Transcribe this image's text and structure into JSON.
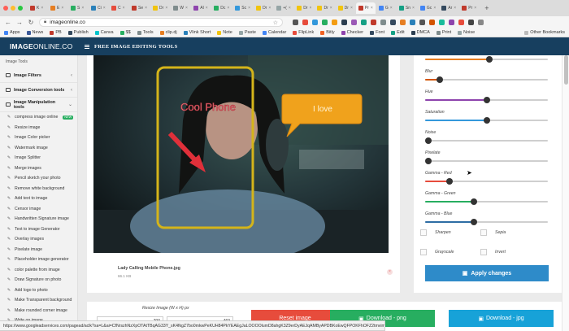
{
  "browser": {
    "tabs": [
      {
        "label": "K",
        "color": "#c0392b"
      },
      {
        "label": "E",
        "color": "#e67e22"
      },
      {
        "label": "S",
        "color": "#27ae60"
      },
      {
        "label": "Ci",
        "color": "#2980b9"
      },
      {
        "label": "C",
        "color": "#e74c3c"
      },
      {
        "label": "Se",
        "color": "#c0392b"
      },
      {
        "label": "Dr",
        "color": "#f1c40f"
      },
      {
        "label": "W",
        "color": "#7f8c8d"
      },
      {
        "label": "Al",
        "color": "#8e44ad"
      },
      {
        "label": "Dc",
        "color": "#27ae60"
      },
      {
        "label": "Sc",
        "color": "#3498db"
      },
      {
        "label": "Dr",
        "color": "#f1c40f"
      },
      {
        "label": "+(",
        "color": "#95a5a6"
      },
      {
        "label": "Dr",
        "color": "#f1c40f"
      },
      {
        "label": "Dr",
        "color": "#f1c40f"
      },
      {
        "label": "Dr",
        "color": "#f1c40f"
      },
      {
        "label": "Pr",
        "color": "#c0392b",
        "active": true
      },
      {
        "label": "G",
        "color": "#4285f4"
      },
      {
        "label": "Sn",
        "color": "#16a085"
      },
      {
        "label": "Gc",
        "color": "#4285f4"
      },
      {
        "label": "Ar",
        "color": "#34495e"
      },
      {
        "label": "Pr",
        "color": "#c0392b"
      }
    ],
    "new_tab": "+",
    "url": "imageonline.co",
    "bookmarks": [
      {
        "label": "Apps",
        "color": "#4285f4"
      },
      {
        "label": "News",
        "color": "#3b5998"
      },
      {
        "label": "PB",
        "color": "#c0392b"
      },
      {
        "label": "Publish",
        "color": "#34495e"
      },
      {
        "label": "Canva",
        "color": "#00c4cc"
      },
      {
        "label": "$$",
        "color": "#27ae60"
      },
      {
        "label": "Tools",
        "color": "#7f8c8d"
      },
      {
        "label": "clip.dj",
        "color": "#e67e22"
      },
      {
        "label": "Vlink Short",
        "color": "#2980b9"
      },
      {
        "label": "Note",
        "color": "#f1c40f"
      },
      {
        "label": "Paste",
        "color": "#95a5a6"
      },
      {
        "label": "Calendar",
        "color": "#4285f4"
      },
      {
        "label": "FlipLink",
        "color": "#e74c3c"
      },
      {
        "label": "Bitly",
        "color": "#ee6123"
      },
      {
        "label": "Checker",
        "color": "#8e44ad"
      },
      {
        "label": "Font",
        "color": "#34495e"
      },
      {
        "label": "Edit",
        "color": "#16a085"
      },
      {
        "label": "DMCA",
        "color": "#2c3e50"
      },
      {
        "label": "Print",
        "color": "#7f8c8d"
      },
      {
        "label": "Noise",
        "color": "#95a5a6"
      }
    ],
    "other_bookmarks": "Other Bookmarks"
  },
  "site": {
    "logo_bold": "IMAGE",
    "logo_thin": "ONLINE.CO",
    "menu_label": "FREE IMAGE EDITING TOOLS"
  },
  "sidebar": {
    "title": "Image Tools",
    "sections": [
      {
        "label": "Image Filters",
        "chevron": "‹"
      },
      {
        "label": "Image Conversion tools",
        "chevron": "‹"
      },
      {
        "label": "Image Manipulation tools",
        "chevron": "⌄"
      }
    ],
    "items": [
      {
        "label": "compress image online",
        "icon": "✎",
        "badge": "NEW"
      },
      {
        "label": "Resize image",
        "icon": "✎"
      },
      {
        "label": "Image Color picker",
        "icon": "✎"
      },
      {
        "label": "Watermark image",
        "icon": "✎"
      },
      {
        "label": "Image Splitter",
        "icon": "✎"
      },
      {
        "label": "Merge images",
        "icon": "✎"
      },
      {
        "label": "Pencil sketch your photo",
        "icon": "✎"
      },
      {
        "label": "Remove white background",
        "icon": "✎"
      },
      {
        "label": "Add text to image",
        "icon": "✎"
      },
      {
        "label": "Censor image",
        "icon": "✎"
      },
      {
        "label": "Handwritten Signature image",
        "icon": "✎"
      },
      {
        "label": "Text to image Generator",
        "icon": "✎"
      },
      {
        "label": "Overlay images",
        "icon": "✎"
      },
      {
        "label": "Pixelate image",
        "icon": "✎"
      },
      {
        "label": "Placeholder image generator",
        "icon": "✎"
      },
      {
        "label": "color palette from image",
        "icon": "✎"
      },
      {
        "label": "Draw Signature on photo",
        "icon": "✎"
      },
      {
        "label": "Add logo to photo",
        "icon": "✎"
      },
      {
        "label": "Make Transparent background",
        "icon": "✎"
      },
      {
        "label": "Make rounded corner image",
        "icon": "✎"
      },
      {
        "label": "Write on image",
        "icon": "✎"
      }
    ]
  },
  "editor": {
    "photo_text_left": "Cool Phone",
    "photo_text_right": "I love",
    "file_name": "Lady Calling Mobile Phone.jpg",
    "file_size": "66.1 KB",
    "remove_icon": "×"
  },
  "adjustments": {
    "sliders": [
      {
        "label": "",
        "value": 0.52,
        "color": "#e67e22"
      },
      {
        "label": "Blur",
        "value": 0.12,
        "color": "#d35400"
      },
      {
        "label": "Hue",
        "value": 0.5,
        "color": "#8e44ad"
      },
      {
        "label": "Saturation",
        "value": 0.5,
        "color": "#3498db"
      },
      {
        "label": "Noise",
        "value": 0.0,
        "color": "#2c3e50"
      },
      {
        "label": "Pixelate",
        "value": 0.0,
        "color": "#2c3e50"
      },
      {
        "label": "Gamma - Red",
        "value": 0.2,
        "color": "#e74c3c"
      },
      {
        "label": "Gamma - Green",
        "value": 0.4,
        "color": "#27ae60"
      },
      {
        "label": "Gamma - Blue",
        "value": 0.4,
        "color": "#2e6da4"
      }
    ],
    "checkboxes": [
      {
        "label": "Sharpen"
      },
      {
        "label": "Sepia"
      },
      {
        "label": "Grayscale"
      },
      {
        "label": "Invert"
      }
    ],
    "apply_label": "Apply changes",
    "apply_icon": "▣"
  },
  "bottom": {
    "resize_label": "Resize Image (W x H) px",
    "width_value": "700",
    "height_value": "469",
    "reset_label": "Reset image",
    "png_label": "Download - png",
    "jpg_label": "Download - jpg",
    "download_icon": "▣",
    "colors": {
      "reset": "#e74c3c",
      "png": "#27ae60",
      "jpg": "#17a2d8"
    }
  },
  "status_url": "https://www.googleadservices.com/pagead/aclk?sa=L&ai=CfNrszhNzXpOTAtTBqAG33Y_sK4fkgZ7bo0mkwPeKUH84PkYEAEgJaLOOOOlumD8ahgK3Z9erDyAEJqAMByAPDBKoEwQFPOKFhOFZ2tmvimtzPhWvIrB2C_phzoGQ7duVmOMj_nuBm0AFUQxNy4AaNt0GZeY5PWAv53B5eN1_IFpDAwa-PF1Ru"
}
